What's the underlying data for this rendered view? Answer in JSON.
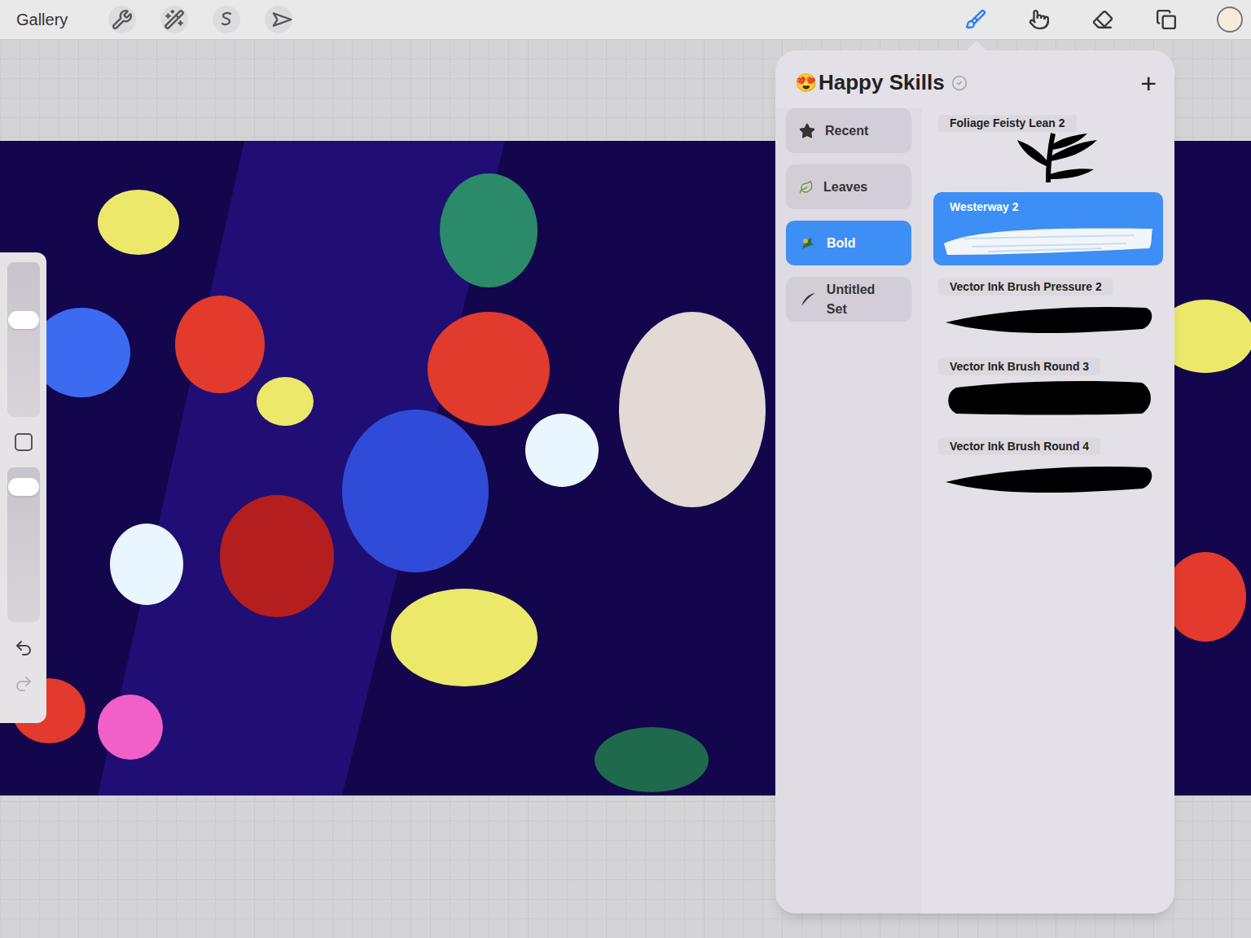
{
  "toolbar": {
    "gallery": "Gallery",
    "left_tools": [
      {
        "kind": "actions",
        "selected": false
      },
      {
        "kind": "adjustments",
        "selected": false
      },
      {
        "kind": "selection",
        "selected": false
      },
      {
        "kind": "transform",
        "selected": false
      }
    ],
    "right_tools": [
      {
        "kind": "brush",
        "selected": true
      },
      {
        "kind": "smudge",
        "selected": false
      },
      {
        "kind": "eraser",
        "selected": false
      },
      {
        "kind": "layers",
        "selected": false
      }
    ],
    "color": "#f6ecdc"
  },
  "sidebar": {
    "size_level": 0.64,
    "opacity_level": 0.92,
    "undo_disabled": false,
    "redo_disabled": true
  },
  "brush_library": {
    "emoji": "😍",
    "title": "Happy Skills",
    "add": "+",
    "sets": [
      {
        "label": "Recent",
        "kind": "star",
        "selected": false
      },
      {
        "label": "Leaves",
        "kind": "leaf",
        "selected": false
      },
      {
        "label": "Bold",
        "kind": "bold",
        "selected": true
      },
      {
        "label": "Untitled Set",
        "kind": "curve",
        "selected": false
      }
    ],
    "brushes": [
      {
        "label": "Foliage Feisty Lean 2",
        "kind": "foliage",
        "selected": false
      },
      {
        "label": "Westerway 2",
        "kind": "paint",
        "selected": true
      },
      {
        "label": "Vector Ink Brush Pressure 2",
        "kind": "taper",
        "selected": false
      },
      {
        "label": "Vector Ink Brush Round 3",
        "kind": "round",
        "selected": false
      },
      {
        "label": "Vector Ink Brush Round 4",
        "kind": "taper",
        "selected": false
      }
    ]
  }
}
